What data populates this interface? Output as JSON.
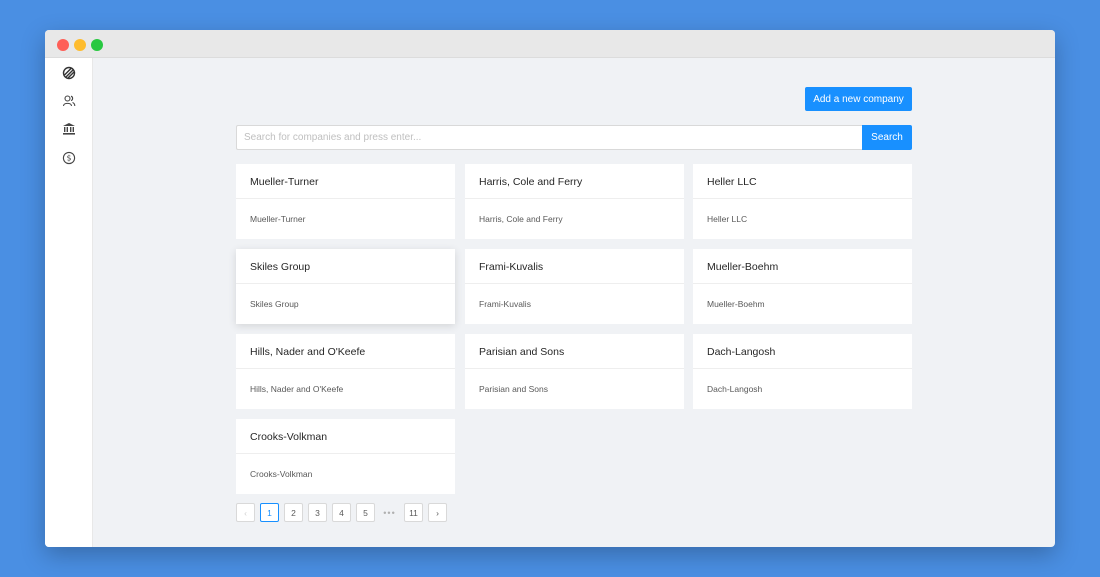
{
  "toolbar": {
    "add_label": "Add a new company"
  },
  "search": {
    "placeholder": "Search for companies and press enter...",
    "button_label": "Search"
  },
  "sidebar": {
    "items": [
      {
        "icon": "logo-icon"
      },
      {
        "icon": "users-icon"
      },
      {
        "icon": "bank-icon"
      },
      {
        "icon": "dollar-icon"
      }
    ]
  },
  "companies": [
    {
      "title": "Mueller-Turner",
      "body": "Mueller-Turner"
    },
    {
      "title": "Harris, Cole and Ferry",
      "body": "Harris, Cole and Ferry"
    },
    {
      "title": "Heller LLC",
      "body": "Heller LLC"
    },
    {
      "title": "Skiles Group",
      "body": "Skiles Group"
    },
    {
      "title": "Frami-Kuvalis",
      "body": "Frami-Kuvalis"
    },
    {
      "title": "Mueller-Boehm",
      "body": "Mueller-Boehm"
    },
    {
      "title": "Hills, Nader and O'Keefe",
      "body": "Hills, Nader and O'Keefe"
    },
    {
      "title": "Parisian and Sons",
      "body": "Parisian and Sons"
    },
    {
      "title": "Dach-Langosh",
      "body": "Dach-Langosh"
    },
    {
      "title": "Crooks-Volkman",
      "body": "Crooks-Volkman"
    }
  ],
  "pagination": {
    "prev": "‹",
    "pages": [
      "1",
      "2",
      "3",
      "4",
      "5"
    ],
    "ellipsis": "•••",
    "last": "11",
    "next": "›",
    "current": "1"
  },
  "colors": {
    "accent": "#1890ff",
    "desktop": "#4a8fe3"
  }
}
